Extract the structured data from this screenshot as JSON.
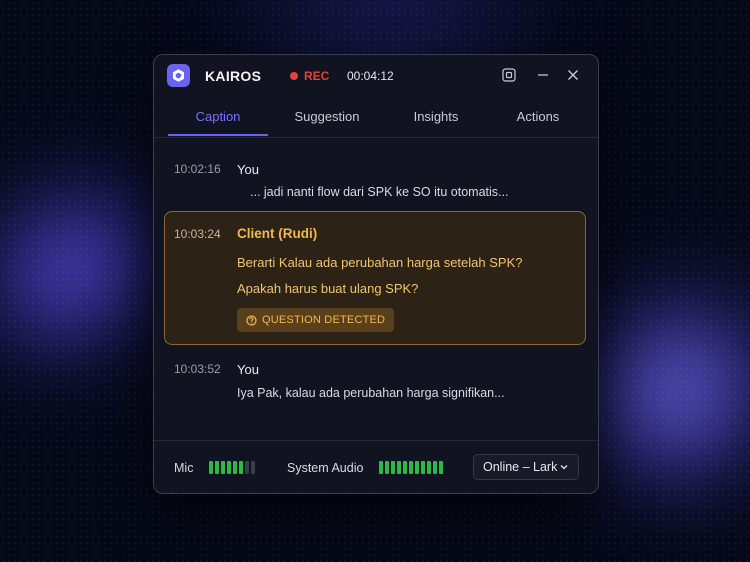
{
  "app": {
    "name": "KAIROS",
    "rec_label": "REC",
    "timer": "00:04:12"
  },
  "tabs": [
    {
      "label": "Caption",
      "active": true
    },
    {
      "label": "Suggestion",
      "active": false
    },
    {
      "label": "Insights",
      "active": false
    },
    {
      "label": "Actions",
      "active": false
    }
  ],
  "messages": [
    {
      "time": "10:02:16",
      "speaker": "You",
      "text": "... jadi nanti flow dari SPK ke SO itu otomatis..."
    },
    {
      "time": "10:03:24",
      "speaker": "Client (Rudi)",
      "lines": [
        "Berarti Kalau ada perubahan harga setelah SPK?",
        "Apakah harus buat ulang SPK?"
      ],
      "badge": "QUESTION DETECTED"
    },
    {
      "time": "10:03:52",
      "speaker": "You",
      "text": "Iya Pak, kalau ada perubahan harga signifikan..."
    }
  ],
  "footer": {
    "mic_label": "Mic",
    "mic_level": 0.75,
    "system_audio_label": "System Audio",
    "system_audio_level": 1.0,
    "source_select": "Online – Lark"
  },
  "colors": {
    "accent": "#6b62f5",
    "rec": "#e24334",
    "question": "#f2b94a",
    "meter": "#2fb843"
  },
  "icons": [
    "kairos-logo-icon",
    "rec-dot-icon",
    "pip-icon",
    "minimize-icon",
    "close-icon",
    "question-icon",
    "chevron-down-icon"
  ]
}
